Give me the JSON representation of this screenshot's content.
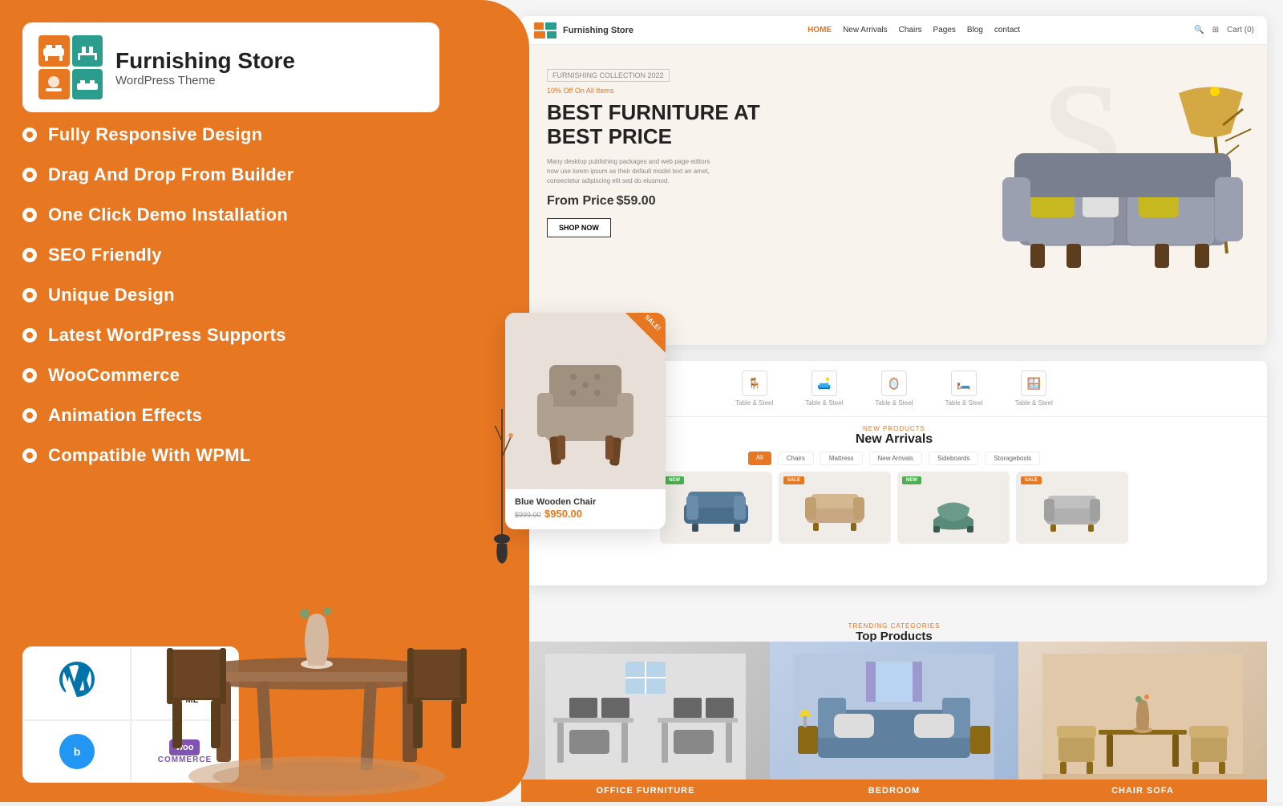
{
  "brand": {
    "name": "Furnishing Store",
    "subtitle": "WordPress Theme"
  },
  "features": [
    "Fully Responsive Design",
    "Drag And Drop From Builder",
    "One Click Demo Installation",
    "SEO Friendly",
    "Unique Design",
    "Latest WordPress Supports",
    "WooCommerce",
    "Animation Effects",
    "Compatible With WPML"
  ],
  "nav": {
    "links": [
      "HOME",
      "New Arrivals",
      "Chairs",
      "Pages",
      "Blog",
      "contact"
    ],
    "cart": "Cart (0)"
  },
  "hero": {
    "tag": "FURNISHING COLLECTION 2022",
    "sale": "10% Off On All Items",
    "title": "BEST FURNITURE AT\nBEST PRICE",
    "desc": "Many desktop publishing packages and web page editors now use lorem ipsum as their default model text an amet, consectetur adipiscing elit sed do eiusmod.",
    "price_label": "From Price",
    "price": "$59.00",
    "btn": "SHOP NOW"
  },
  "categories": {
    "icons": [
      "Table & Steel",
      "Table & Steel",
      "Table & Steel",
      "Table & Steel",
      "Table & Steel"
    ],
    "new_arrivals_sub": "NEW PRODUCTS",
    "new_arrivals_title": "New Arrivals",
    "filter_tabs": [
      "All",
      "Chairs",
      "Mattress",
      "New Arrivals",
      "Sideboards",
      "Storageboxls"
    ],
    "top_products_sub": "Trending Categories",
    "top_products_title": "Top Products"
  },
  "floating_product": {
    "badge": "SALE!",
    "name": "Blue Wooden Chair",
    "old_price": "$999.00",
    "new_price": "$950.00"
  },
  "bottom_categories": [
    {
      "label": "OFFICE FURNITURE"
    },
    {
      "label": "BEDROOM"
    },
    {
      "label": "CHAIR SOFA"
    }
  ],
  "tech_logos": [
    "WordPress",
    "WPML",
    "BuddyPress",
    "WooCommerce"
  ]
}
